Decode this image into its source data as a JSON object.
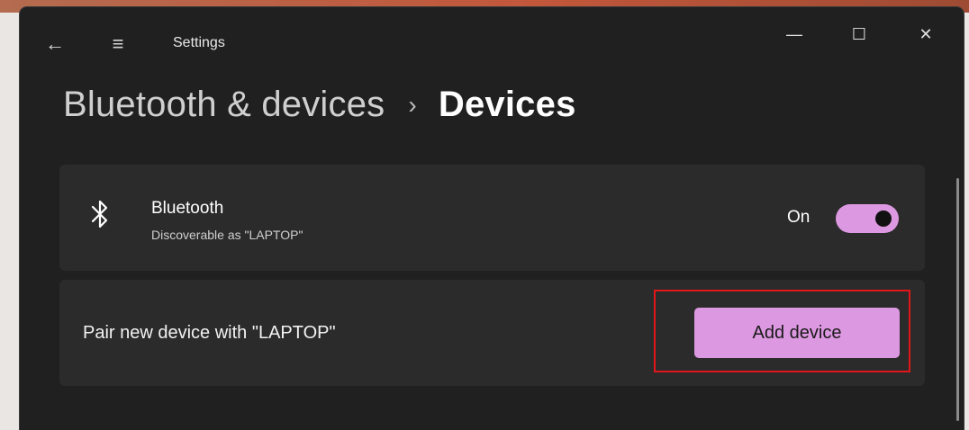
{
  "window": {
    "title": "Settings",
    "controls": {
      "minimize": "—",
      "maximize": "☐",
      "close": "✕"
    }
  },
  "titlebar": {
    "back_icon": "←",
    "menu_icon": "≡"
  },
  "breadcrumb": {
    "parent": "Bluetooth & devices",
    "separator": "›",
    "current": "Devices"
  },
  "bluetooth_card": {
    "icon": "bluetooth-icon",
    "title": "Bluetooth",
    "subtitle": "Discoverable as \"LAPTOP\"",
    "toggle_state_label": "On",
    "toggle_on": true
  },
  "pair_card": {
    "text": "Pair new device with \"LAPTOP\"",
    "button_label": "Add device"
  },
  "colors": {
    "accent": "#dc98e0",
    "window_bg": "#202020",
    "card_bg": "#2b2b2b",
    "highlight": "#e0161a"
  }
}
